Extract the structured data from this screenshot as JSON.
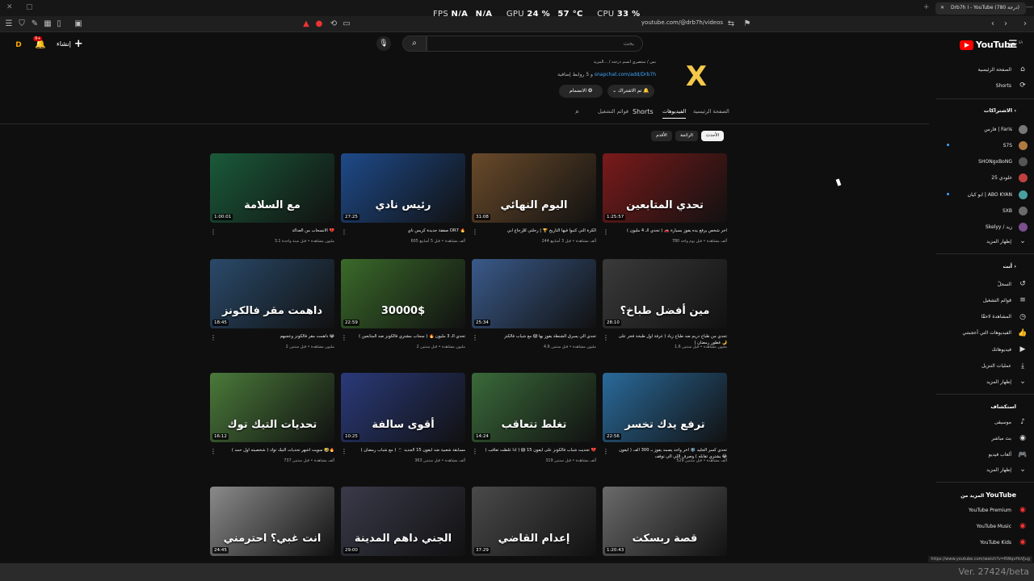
{
  "browser": {
    "perf": {
      "fps_label": "FPS",
      "fps_value": "N/A",
      "fps_value2": "N/A",
      "gpu_label": "GPU",
      "gpu_value": "24 %",
      "gpu_temp": "57 °C",
      "cpu_label": "CPU",
      "cpu_value": "33 %"
    },
    "tab_title": "Drb7h I - YouTube (درجة 780)",
    "url": "youtube.com/@drb7h/videos",
    "version": "Ver. 27424/beta",
    "hover_url": "https://www.youtube.com/watch?v=RWqvHsVJug"
  },
  "masthead": {
    "logo_text": "YouTube",
    "logo_region": "SA",
    "search_placeholder": "بحث",
    "create_label": "إنشاء",
    "notifications_count": "9+"
  },
  "sidebar": {
    "top": [
      {
        "label": "الصفحة الرئيسية",
        "icon": "home-icon"
      },
      {
        "label": "Shorts",
        "icon": "shorts-icon"
      }
    ],
    "subscriptions_header": "الاشتراكات",
    "subscriptions": [
      {
        "label": "فارس | Faris",
        "color": "#777777"
      },
      {
        "label": "S7S",
        "color": "#b07a40",
        "dot": true
      },
      {
        "label": "SHONgxBoNG",
        "color": "#555555"
      },
      {
        "label": "خلودي 25",
        "color": "#c04040"
      },
      {
        "label": "ابو كيان | ABO KYAN",
        "color": "#4aa0a0",
        "dot": true
      },
      {
        "label": "SXB",
        "color": "#6a6a6a"
      },
      {
        "label": "Skelyy / زيد",
        "color": "#7a5090"
      }
    ],
    "show_more_1": "إظهار المزيد",
    "you_header": "أنت",
    "you_items": [
      {
        "label": "السجلّ",
        "icon": "history-icon"
      },
      {
        "label": "قوائم التشغيل",
        "icon": "playlist-icon"
      },
      {
        "label": "المشاهدة لاحقًا",
        "icon": "clock-icon"
      },
      {
        "label": "الفيديوهات التي أعجبتني",
        "icon": "like-icon"
      },
      {
        "label": "فيديوهاتك",
        "icon": "video-icon"
      },
      {
        "label": "عمليات التنزيل",
        "icon": "download-icon"
      }
    ],
    "show_more_2": "إظهار المزيد",
    "explore_header": "استكشاف",
    "explore_items": [
      {
        "label": "موسيقى",
        "icon": "music-icon"
      },
      {
        "label": "بث مباشر",
        "icon": "live-icon"
      },
      {
        "label": "ألعاب فيديو",
        "icon": "gaming-icon"
      }
    ],
    "show_more_3": "إظهار المزيد",
    "more_from_header": "المزيد من",
    "more_from_brand": "YouTube",
    "more_from": [
      {
        "label": "YouTube Premium"
      },
      {
        "label": "YouTube Music"
      },
      {
        "label": "YouTube Kids"
      }
    ]
  },
  "channel": {
    "logo_glyph": "X",
    "desc_line": "بس / منتصري انسم درجته / ...المزيد",
    "link_prefix": "و 5 روابط إضافية",
    "link": "snapchat.com/add/Drb7h",
    "subscribe_label": "تم الاشتراك",
    "join_label": "الانضمام",
    "tabs": [
      "الصفحة الرئيسية",
      "الفيديوهات",
      "Shorts",
      "قوائم التشغيل"
    ],
    "active_tab": "الفيديوهات",
    "chips": [
      "الأحدث",
      "الرائجة",
      "الأقدم"
    ]
  },
  "videos": [
    {
      "title": "آخر شخص يرفع يده يفوز بسيارة 🚗 ( تحدي الـ 4 مليون )",
      "meta": "780 ألف مشاهدة • قبل يوم واحد",
      "duration": "1:25:57",
      "thumb_text": "تحدي المتابعين",
      "bg": "#7a1a1a"
    },
    {
      "title": "الكرة التي كتبوا فيها التاريخ 🏆 | رحلتي للإرجاع أبي",
      "meta": "244 ألف مشاهدة • قبل 3 أسابيع",
      "duration": "31:08",
      "thumb_text": "اليوم النهائي",
      "bg": "#6a4a2a"
    },
    {
      "title": "صفقة جديدة كريس ناي DR7 🔥",
      "meta": "605 ألف مشاهدة • قبل 5 أسابيع",
      "duration": "27:25",
      "thumb_text": "رئيس نادي",
      "bg": "#1e4a8a"
    },
    {
      "title": "الانسحاب من العدالة 💔",
      "meta": "3.1 مليون مشاهدة • قبل سنة واحدة",
      "duration": "1:00:01",
      "thumb_text": "مع السلامة",
      "bg": "#1a5a3a"
    },
    {
      "title": "تحدي من طباخ دريم ضد طباخ زياد ( غرفة أول طبخة فخر على فطور رمضان ) 🌙",
      "meta": "1.6 مليون مشاهدة • قبل سنتين",
      "duration": "28:10",
      "thumb_text": "مين أفضل طباخ؟",
      "bg": "#3a3a3a"
    },
    {
      "title": "تحدي الي يسرق الشنطة يفوز بها 😱 مع شباب فالكنز",
      "meta": "4.6 مليون مشاهدة • قبل سنتين",
      "duration": "25:34",
      "thumb_text": "",
      "bg": "#3a5a8a"
    },
    {
      "title": "تحدي الـ 3 مليون 🔥 ( سحاب مشتري فالكونز ضد المتابعين )",
      "meta": "2 مليون مشاهدة • قبل سنتين",
      "duration": "22:59",
      "thumb_text": "30000$",
      "bg": "#3a6a2a"
    },
    {
      "title": "داهمت مقر فالكونز وعجبهم 😂",
      "meta": "2 مليون مشاهدة • قبل سنتين",
      "duration": "18:45",
      "thumb_text": "داهمت مقر فالكونز",
      "bg": "#2a4a6a"
    },
    {
      "title": "تحدي كسر الجليد ❄️ آخر واحد يصمد يفوز بـ 300 ألف ( ايفون يشتري تقابله ) وصرف اللي الي توقف 😂",
      "meta": "529 ألف مشاهدة • قبل سنتين",
      "duration": "22:56",
      "thumb_text": "ترفع يدك تخسر",
      "bg": "#2a6a9a"
    },
    {
      "title": "تحديت شباب فالكونز على ايفون 15 😱 ( اذا غلطت تعاقب ) 💔",
      "meta": "319 ألف مشاهدة • قبل سنتين",
      "duration": "14:24",
      "thumb_text": "تغلط تتعاقب",
      "bg": "#3a6a3a"
    },
    {
      "title": "مسابقة شعبية ضد ايفون 15 الجديد 📱 ( مع شباب رمضان )",
      "meta": "363 ألف مشاهدة • قبل سنتين",
      "duration": "10:25",
      "thumb_text": "أقوى سالفة",
      "bg": "#2a3a7a"
    },
    {
      "title": "سويت أشهر تحديات التيك توك ( شخصيته أول حمد ) 🤣🔥",
      "meta": "737 ألف مشاهدة • قبل سنتين",
      "duration": "16:12",
      "thumb_text": "تحديات التيك توك",
      "bg": "#4a7a3a"
    },
    {
      "title": "",
      "meta": "",
      "duration": "1:20:43",
      "thumb_text": "قصة ربسكت",
      "bg": "#6a6a6a"
    },
    {
      "title": "",
      "meta": "",
      "duration": "37:29",
      "thumb_text": "إعدام القاضي",
      "bg": "#4a4a4a"
    },
    {
      "title": "",
      "meta": "",
      "duration": "29:00",
      "thumb_text": "الجني داهم المدينة",
      "bg": "#3a3a4a"
    },
    {
      "title": "",
      "meta": "",
      "duration": "24:45",
      "thumb_text": "انت غبي؟ احترمني",
      "bg": "#8a8a8a"
    }
  ]
}
